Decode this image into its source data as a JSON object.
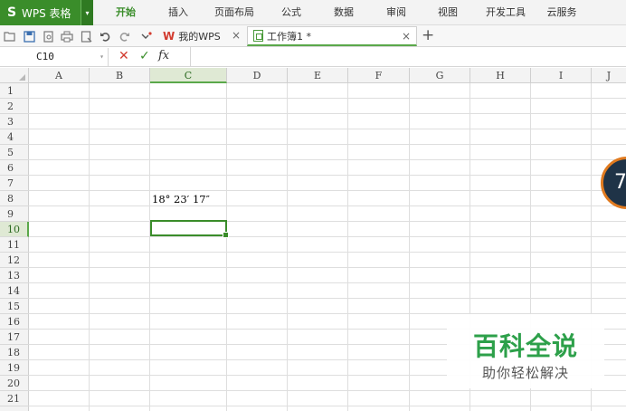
{
  "app": {
    "logo_glyph": "S",
    "name": "WPS 表格",
    "drop_glyph": "▾"
  },
  "menu": [
    {
      "label": "开始",
      "active": true
    },
    {
      "label": "插入"
    },
    {
      "label": "页面布局"
    },
    {
      "label": "公式"
    },
    {
      "label": "数据"
    },
    {
      "label": "审阅"
    },
    {
      "label": "视图"
    },
    {
      "label": "开发工具"
    },
    {
      "label": "云服务"
    }
  ],
  "toolbar": {
    "icons": [
      "open-folder-icon",
      "save-icon",
      "print-preview-icon",
      "print-icon",
      "page-preview-icon",
      "undo-icon",
      "redo-icon",
      "customize-icon"
    ]
  },
  "tabs": [
    {
      "label": "我的WPS",
      "logo": "W",
      "close": "×"
    },
    {
      "label": "工作簿1 *",
      "close": "×",
      "active": true
    }
  ],
  "new_tab": "+",
  "formula_bar": {
    "name_box": "C10",
    "cancel": "✕",
    "enter": "✓",
    "fx": "fx",
    "value": ""
  },
  "columns": [
    "A",
    "B",
    "C",
    "D",
    "E",
    "F",
    "G",
    "H",
    "I",
    "J"
  ],
  "rows": [
    "1",
    "2",
    "3",
    "4",
    "5",
    "6",
    "7",
    "8",
    "9",
    "10",
    "11",
    "12",
    "13",
    "14",
    "15",
    "16",
    "17",
    "18",
    "19",
    "20",
    "21"
  ],
  "selected_column": "C",
  "selected_row": "10",
  "cell_C8": "18° 23′ 17″",
  "float_badge": "7",
  "watermark": {
    "title": "百科全说",
    "subtitle": "助你轻松解决"
  }
}
